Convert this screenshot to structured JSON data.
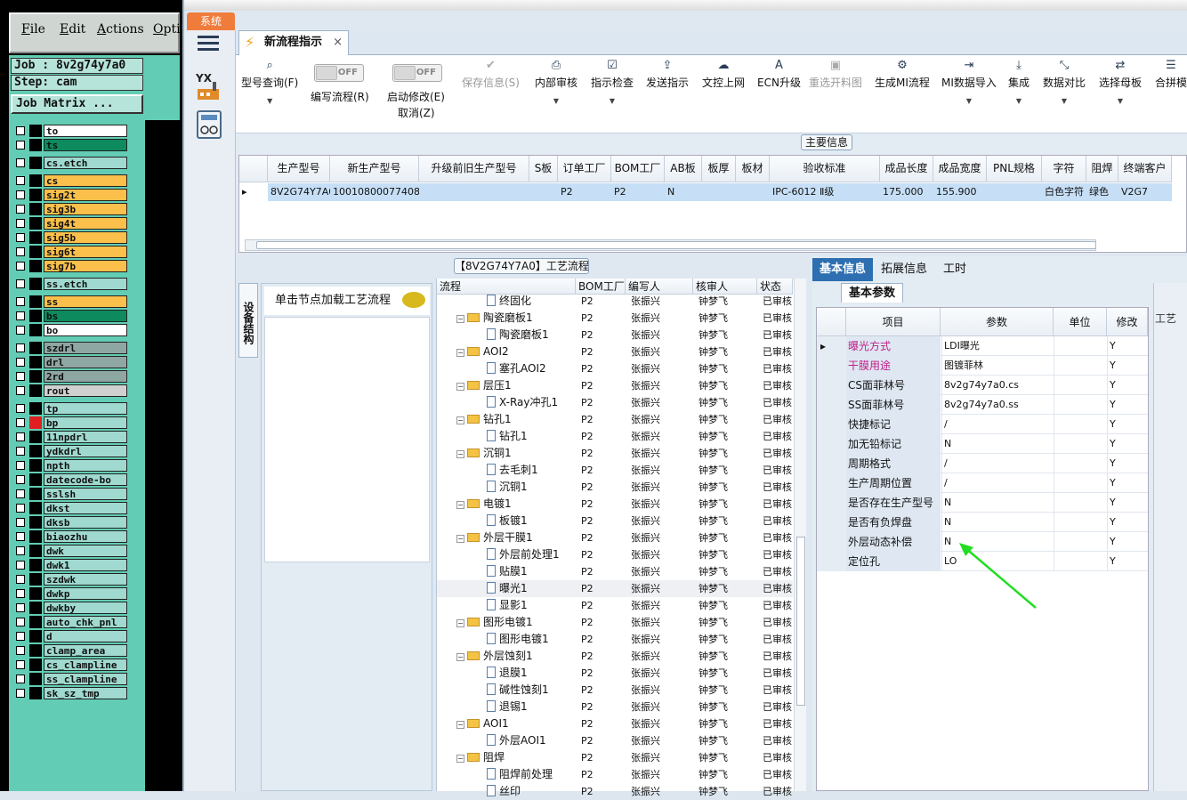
{
  "cam": {
    "menu": [
      "File",
      "Edit",
      "Actions",
      "Opti"
    ],
    "job_label": "Job : 8v2g74y7a0",
    "step_label": "Step: cam",
    "job_matrix_button": "Job Matrix ...",
    "layers": [
      {
        "name": "to",
        "color": "white"
      },
      {
        "name": "ts",
        "color": "green"
      },
      {
        "name": "cs.etch",
        "color": "teal"
      },
      {
        "name": "cs",
        "color": "orange"
      },
      {
        "name": "sig2t",
        "color": "orange"
      },
      {
        "name": "sig3b",
        "color": "orange"
      },
      {
        "name": "sig4t",
        "color": "orange"
      },
      {
        "name": "sig5b",
        "color": "orange"
      },
      {
        "name": "sig6t",
        "color": "orange"
      },
      {
        "name": "sig7b",
        "color": "orange"
      },
      {
        "name": "ss.etch",
        "color": "teal"
      },
      {
        "name": "ss",
        "color": "orange"
      },
      {
        "name": "bs",
        "color": "green"
      },
      {
        "name": "bo",
        "color": "white"
      },
      {
        "name": "szdrl",
        "color": "gray"
      },
      {
        "name": "drl",
        "color": "gray"
      },
      {
        "name": "2rd",
        "color": "gray"
      },
      {
        "name": "rout",
        "color": "lgray"
      },
      {
        "name": "tp",
        "color": "teal"
      },
      {
        "name": "bp",
        "color": "teal"
      },
      {
        "name": "11npdrl",
        "color": "teal"
      },
      {
        "name": "ydkdrl",
        "color": "teal"
      },
      {
        "name": "npth",
        "color": "teal"
      },
      {
        "name": "datecode-bo",
        "color": "teal"
      },
      {
        "name": "sslsh",
        "color": "teal"
      },
      {
        "name": "dkst",
        "color": "teal"
      },
      {
        "name": "dksb",
        "color": "teal"
      },
      {
        "name": "biaozhu",
        "color": "teal"
      },
      {
        "name": "dwk",
        "color": "teal"
      },
      {
        "name": "dwk1",
        "color": "teal"
      },
      {
        "name": "szdwk",
        "color": "teal"
      },
      {
        "name": "dwkp",
        "color": "teal"
      },
      {
        "name": "dwkby",
        "color": "teal"
      },
      {
        "name": "auto_chk_pnl",
        "color": "teal"
      },
      {
        "name": "d",
        "color": "teal"
      },
      {
        "name": "clamp_area",
        "color": "teal"
      },
      {
        "name": "cs_clampline",
        "color": "teal"
      },
      {
        "name": "ss_clampline",
        "color": "teal"
      },
      {
        "name": "sk_sz_tmp",
        "color": "teal"
      }
    ]
  },
  "app": {
    "sys_tab": "系统",
    "doc_tab": "新流程指示",
    "doc_tab_close": "×",
    "toolbar": {
      "query": "型号查询(F)",
      "edit_flow": "编写流程(R)",
      "start_modify": "启动修改(E)",
      "cancel": "取消(Z)",
      "save": "保存信息(S)",
      "internal_review": "内部审核",
      "check": "指示检查",
      "send": "发送指示",
      "upload": "文控上网",
      "ecn": "ECN升级",
      "reselect": "重选开料图",
      "gen_mi": "生成MI流程",
      "mi_import": "MI数据导入",
      "integrate": "集成",
      "compare": "数据对比",
      "select_master": "选择母板",
      "merge": "合拼模",
      "toggle_off": "OFF"
    },
    "main_info_title": "主要信息",
    "main_grid": {
      "headers": [
        "生产型号",
        "新生产型号",
        "升级前旧生产型号",
        "S板",
        "订单工厂",
        "BOM工厂",
        "AB板",
        "板厚",
        "板材",
        "验收标准",
        "成品长度",
        "成品宽度",
        "PNL规格",
        "字符",
        "阻焊",
        "终端客户"
      ],
      "row": [
        "8V2G74Y7A0",
        "10010800077408",
        "",
        "",
        "P2",
        "P2",
        "N",
        "",
        "",
        "IPC-6012 Ⅱ级",
        "175.000",
        "155.900",
        "",
        "白色字符",
        "绿色",
        "V2G7"
      ]
    },
    "flow_title": "【8V2G74Y7A0】工艺流程",
    "vtab": "设备结构",
    "node_hint": "单击节点加载工艺流程",
    "tree_headers": [
      "流程",
      "BOM工厂",
      "编写人",
      "核审人",
      "状态"
    ],
    "tree_rows": [
      {
        "name": "终固化",
        "level": 1,
        "type": "file"
      },
      {
        "name": "陶瓷磨板1",
        "level": 0,
        "type": "folder"
      },
      {
        "name": "陶瓷磨板1",
        "level": 1,
        "type": "file"
      },
      {
        "name": "AOI2",
        "level": 0,
        "type": "folder"
      },
      {
        "name": "塞孔AOI2",
        "level": 1,
        "type": "file"
      },
      {
        "name": "层压1",
        "level": 0,
        "type": "folder"
      },
      {
        "name": "X-Ray冲孔1",
        "level": 1,
        "type": "file"
      },
      {
        "name": "钻孔1",
        "level": 0,
        "type": "folder"
      },
      {
        "name": "钻孔1",
        "level": 1,
        "type": "file"
      },
      {
        "name": "沉铜1",
        "level": 0,
        "type": "folder"
      },
      {
        "name": "去毛刺1",
        "level": 1,
        "type": "file"
      },
      {
        "name": "沉铜1",
        "level": 1,
        "type": "file"
      },
      {
        "name": "电镀1",
        "level": 0,
        "type": "folder"
      },
      {
        "name": "板镀1",
        "level": 1,
        "type": "file"
      },
      {
        "name": "外层干膜1",
        "level": 0,
        "type": "folder"
      },
      {
        "name": "外层前处理1",
        "level": 1,
        "type": "file"
      },
      {
        "name": "贴膜1",
        "level": 1,
        "type": "file"
      },
      {
        "name": "曝光1",
        "level": 1,
        "type": "file",
        "selected": true
      },
      {
        "name": "显影1",
        "level": 1,
        "type": "file"
      },
      {
        "name": "图形电镀1",
        "level": 0,
        "type": "folder"
      },
      {
        "name": "图形电镀1",
        "level": 1,
        "type": "file"
      },
      {
        "name": "外层蚀刻1",
        "level": 0,
        "type": "folder"
      },
      {
        "name": "退膜1",
        "level": 1,
        "type": "file"
      },
      {
        "name": "碱性蚀刻1",
        "level": 1,
        "type": "file"
      },
      {
        "name": "退锡1",
        "level": 1,
        "type": "file"
      },
      {
        "name": "AOI1",
        "level": 0,
        "type": "folder"
      },
      {
        "name": "外层AOI1",
        "level": 1,
        "type": "file"
      },
      {
        "name": "阻焊",
        "level": 0,
        "type": "folder"
      },
      {
        "name": "阻焊前处理",
        "level": 1,
        "type": "file"
      },
      {
        "name": "丝印",
        "level": 1,
        "type": "file"
      }
    ],
    "tree_common": {
      "bom": "P2",
      "writer": "张振兴",
      "reviewer": "钟梦飞",
      "status": "已审核"
    },
    "right_tabs": [
      "基本信息",
      "拓展信息",
      "工时"
    ],
    "sub_tab": "基本参数",
    "param_headers": [
      "项目",
      "参数",
      "单位",
      "修改"
    ],
    "params": [
      {
        "name": "曝光方式",
        "value": "LDI曝光",
        "unit": "",
        "mod": "Y",
        "highlight": true
      },
      {
        "name": "干膜用途",
        "value": "图镀菲林",
        "unit": "",
        "mod": "Y",
        "highlight": true
      },
      {
        "name": "CS面菲林号",
        "value": "8v2g74y7a0.cs",
        "unit": "",
        "mod": "Y"
      },
      {
        "name": "SS面菲林号",
        "value": "8v2g74y7a0.ss",
        "unit": "",
        "mod": "Y"
      },
      {
        "name": "快捷标记",
        "value": "/",
        "unit": "",
        "mod": "Y"
      },
      {
        "name": "加无铅标记",
        "value": "N",
        "unit": "",
        "mod": "Y"
      },
      {
        "name": "周期格式",
        "value": "/",
        "unit": "",
        "mod": "Y"
      },
      {
        "name": "生产周期位置",
        "value": "/",
        "unit": "",
        "mod": "Y"
      },
      {
        "name": "是否存在生产型号",
        "value": "N",
        "unit": "",
        "mod": "Y"
      },
      {
        "name": "是否有负焊盘",
        "value": "N",
        "unit": "",
        "mod": "Y"
      },
      {
        "name": "外层动态补偿",
        "value": "N",
        "unit": "",
        "mod": "Y"
      },
      {
        "name": "定位孔",
        "value": "LO",
        "unit": "",
        "mod": "Y"
      }
    ],
    "far_right_tab": "工艺"
  }
}
